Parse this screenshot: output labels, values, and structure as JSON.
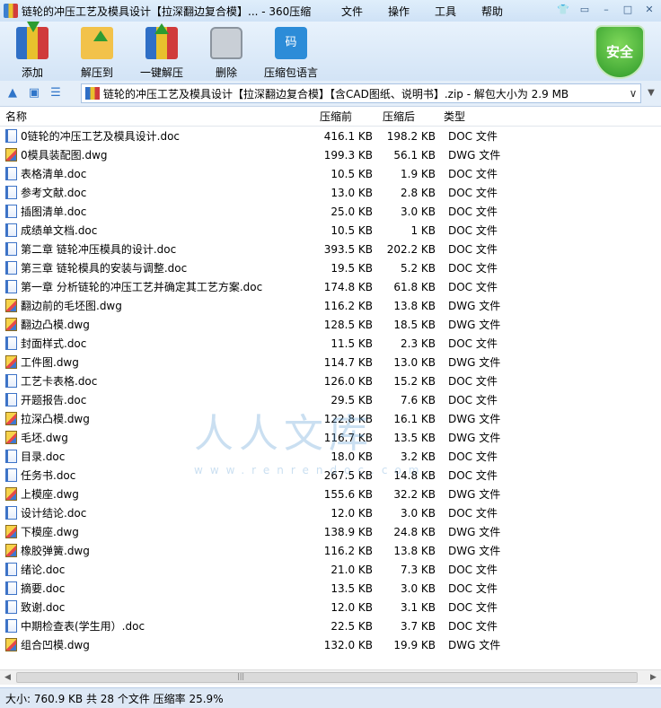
{
  "title": "链轮的冲压工艺及模具设计【拉深翻边复合模】... - 360压缩",
  "menu": [
    "文件",
    "操作",
    "工具",
    "帮助"
  ],
  "toolbar": [
    {
      "label": "添加",
      "icon": "add-icon"
    },
    {
      "label": "解压到",
      "icon": "extract-icon"
    },
    {
      "label": "一键解压",
      "icon": "one-key-extract-icon"
    },
    {
      "label": "删除",
      "icon": "delete-icon"
    },
    {
      "label": "压缩包语言",
      "icon": "archive-language-icon"
    }
  ],
  "toolbar_icon_text": "码",
  "security_badge": "安全",
  "address": "链轮的冲压工艺及模具设计【拉深翻边复合模】【含CAD图纸、说明书】.zip - 解包大小为 2.9 MB",
  "columns": {
    "name": "名称",
    "size": "压缩前",
    "packed": "压缩后",
    "type": "类型"
  },
  "files": [
    {
      "name": "0链轮的冲压工艺及模具设计.doc",
      "size": "416.1 KB",
      "packed": "198.2 KB",
      "type": "DOC 文件",
      "kind": "doc"
    },
    {
      "name": "0模具装配图.dwg",
      "size": "199.3 KB",
      "packed": "56.1 KB",
      "type": "DWG 文件",
      "kind": "dwg"
    },
    {
      "name": "表格清单.doc",
      "size": "10.5 KB",
      "packed": "1.9 KB",
      "type": "DOC 文件",
      "kind": "doc"
    },
    {
      "name": "参考文献.doc",
      "size": "13.0 KB",
      "packed": "2.8 KB",
      "type": "DOC 文件",
      "kind": "doc"
    },
    {
      "name": "插图清单.doc",
      "size": "25.0 KB",
      "packed": "3.0 KB",
      "type": "DOC 文件",
      "kind": "doc"
    },
    {
      "name": "成绩单文档.doc",
      "size": "10.5 KB",
      "packed": "1 KB",
      "type": "DOC 文件",
      "kind": "doc"
    },
    {
      "name": "第二章 链轮冲压模具的设计.doc",
      "size": "393.5 KB",
      "packed": "202.2 KB",
      "type": "DOC 文件",
      "kind": "doc"
    },
    {
      "name": "第三章 链轮模具的安装与调整.doc",
      "size": "19.5 KB",
      "packed": "5.2 KB",
      "type": "DOC 文件",
      "kind": "doc"
    },
    {
      "name": "第一章  分析链轮的冲压工艺并确定其工艺方案.doc",
      "size": "174.8 KB",
      "packed": "61.8 KB",
      "type": "DOC 文件",
      "kind": "doc"
    },
    {
      "name": "翻边前的毛坯图.dwg",
      "size": "116.2 KB",
      "packed": "13.8 KB",
      "type": "DWG 文件",
      "kind": "dwg"
    },
    {
      "name": "翻边凸模.dwg",
      "size": "128.5 KB",
      "packed": "18.5 KB",
      "type": "DWG 文件",
      "kind": "dwg"
    },
    {
      "name": "封面样式.doc",
      "size": "11.5 KB",
      "packed": "2.3 KB",
      "type": "DOC 文件",
      "kind": "doc"
    },
    {
      "name": "工件图.dwg",
      "size": "114.7 KB",
      "packed": "13.0 KB",
      "type": "DWG 文件",
      "kind": "dwg"
    },
    {
      "name": "工艺卡表格.doc",
      "size": "126.0 KB",
      "packed": "15.2 KB",
      "type": "DOC 文件",
      "kind": "doc"
    },
    {
      "name": "开题报告.doc",
      "size": "29.5 KB",
      "packed": "7.6 KB",
      "type": "DOC 文件",
      "kind": "doc"
    },
    {
      "name": "拉深凸模.dwg",
      "size": "122.8 KB",
      "packed": "16.1 KB",
      "type": "DWG 文件",
      "kind": "dwg"
    },
    {
      "name": "毛坯.dwg",
      "size": "116.7 KB",
      "packed": "13.5 KB",
      "type": "DWG 文件",
      "kind": "dwg"
    },
    {
      "name": "目录.doc",
      "size": "18.0 KB",
      "packed": "3.2 KB",
      "type": "DOC 文件",
      "kind": "doc"
    },
    {
      "name": "任务书.doc",
      "size": "267.5 KB",
      "packed": "14.8 KB",
      "type": "DOC 文件",
      "kind": "doc"
    },
    {
      "name": "上模座.dwg",
      "size": "155.6 KB",
      "packed": "32.2 KB",
      "type": "DWG 文件",
      "kind": "dwg"
    },
    {
      "name": "设计结论.doc",
      "size": "12.0 KB",
      "packed": "3.0 KB",
      "type": "DOC 文件",
      "kind": "doc"
    },
    {
      "name": "下模座.dwg",
      "size": "138.9 KB",
      "packed": "24.8 KB",
      "type": "DWG 文件",
      "kind": "dwg"
    },
    {
      "name": "橡胶弹簧.dwg",
      "size": "116.2 KB",
      "packed": "13.8 KB",
      "type": "DWG 文件",
      "kind": "dwg"
    },
    {
      "name": "绪论.doc",
      "size": "21.0 KB",
      "packed": "7.3 KB",
      "type": "DOC 文件",
      "kind": "doc"
    },
    {
      "name": "摘要.doc",
      "size": "13.5 KB",
      "packed": "3.0 KB",
      "type": "DOC 文件",
      "kind": "doc"
    },
    {
      "name": "致谢.doc",
      "size": "12.0 KB",
      "packed": "3.1 KB",
      "type": "DOC 文件",
      "kind": "doc"
    },
    {
      "name": "中期检查表(学生用）.doc",
      "size": "22.5 KB",
      "packed": "3.7 KB",
      "type": "DOC 文件",
      "kind": "doc"
    },
    {
      "name": "组合凹模.dwg",
      "size": "132.0 KB",
      "packed": "19.9 KB",
      "type": "DWG 文件",
      "kind": "dwg"
    }
  ],
  "watermark": {
    "main": "人人文库",
    "sub": "www.renrendoc.com"
  },
  "status": "大小: 760.9 KB 共 28 个文件 压缩率 25.9%"
}
